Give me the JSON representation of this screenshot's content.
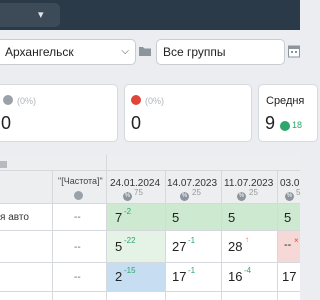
{
  "filters": {
    "city": "Архангельск",
    "groups": "Все группы"
  },
  "stats": [
    {
      "pct": "(0%)",
      "value": "0",
      "icon": "minus-circle-icon",
      "color": "#9aa1a8"
    },
    {
      "pct": "(0%)",
      "value": "0",
      "icon": "arrow-down-circle-icon",
      "color": "#e0453b"
    },
    {
      "title": "Средня",
      "value": "9",
      "delta": "18",
      "icon": "arrow-up-circle-icon",
      "color": "#2ea66c"
    }
  ],
  "table": {
    "freq_header": "\"[Частота]\"",
    "columns": [
      {
        "date": "24.01.2024",
        "count": "75"
      },
      {
        "date": "14.07.2023",
        "count": "25"
      },
      {
        "date": "11.07.2023",
        "count": "25"
      },
      {
        "date": "03.0",
        "count": "5"
      }
    ],
    "rows": [
      {
        "label": "я авто",
        "freq": "--",
        "cells": [
          {
            "value": "7",
            "delta": "-2",
            "delta_color": "#2ea66c",
            "bg": "#cde9cf"
          },
          {
            "value": "5",
            "delta": "",
            "delta_color": "#2ea66c",
            "bg": "#cde9cf"
          },
          {
            "value": "5",
            "delta": "",
            "delta_color": "#2ea66c",
            "bg": "#cde9cf"
          },
          {
            "value": "5",
            "delta": "",
            "delta_color": "#2ea66c",
            "bg": "#cde9cf"
          }
        ]
      },
      {
        "label": "",
        "freq": "--",
        "cells": [
          {
            "value": "5",
            "delta": "-22",
            "delta_color": "#2ea66c",
            "bg": "#e4f3e5"
          },
          {
            "value": "27",
            "delta": "-1",
            "delta_color": "#2ea66c",
            "bg": "#ffffff"
          },
          {
            "value": "28",
            "delta": "↑",
            "delta_color": "#e07a3b",
            "bg": "#ffffff"
          },
          {
            "value": "--",
            "delta": "×",
            "delta_color": "#e0453b",
            "bg": "#f6d9d7"
          }
        ]
      },
      {
        "label": "",
        "freq": "--",
        "cells": [
          {
            "value": "2",
            "delta": "-15",
            "delta_color": "#2ea66c",
            "bg": "#c7def2"
          },
          {
            "value": "17",
            "delta": "-1",
            "delta_color": "#2ea66c",
            "bg": "#ffffff"
          },
          {
            "value": "16",
            "delta": "-4",
            "delta_color": "#2ea66c",
            "bg": "#ffffff"
          },
          {
            "value": "17",
            "delta": "",
            "delta_color": "#2ea66c",
            "bg": "#ffffff"
          }
        ]
      }
    ]
  }
}
